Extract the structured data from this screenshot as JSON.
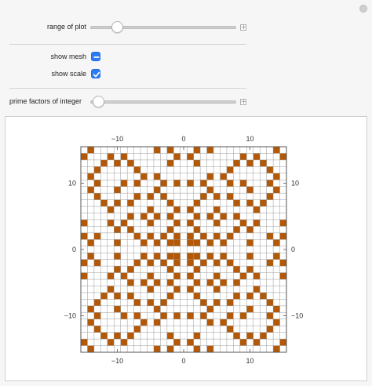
{
  "controls": {
    "range_label": "range of plot",
    "range_value": 0.16,
    "show_mesh_label": "show mesh",
    "show_mesh_state": "indeterminate",
    "show_scale_label": "show scale",
    "show_scale_checked": true,
    "prime_label": "prime factors of integer",
    "prime_value": 0.02
  },
  "colors": {
    "accent": "#2d7cf6",
    "cell": "#b35806",
    "mesh": "#9a9a9a"
  },
  "chart_data": {
    "type": "heatmap",
    "x_range": [
      -15.5,
      15.5
    ],
    "y_range": [
      -15.5,
      15.5
    ],
    "x_ticks": [
      -10,
      0,
      10
    ],
    "y_ticks": [
      -10,
      0,
      10
    ],
    "tick_labels": {
      "top": [
        "−10",
        "0",
        "10"
      ],
      "bottom": [
        "−10",
        "0",
        "10"
      ],
      "left": [
        "10",
        "0",
        "−10"
      ],
      "right": [
        "10",
        "0",
        "−10"
      ]
    },
    "grid": true,
    "rule": "cell (x,y) filled when x²+y² is prime (Gaussian primes)",
    "cells": []
  }
}
